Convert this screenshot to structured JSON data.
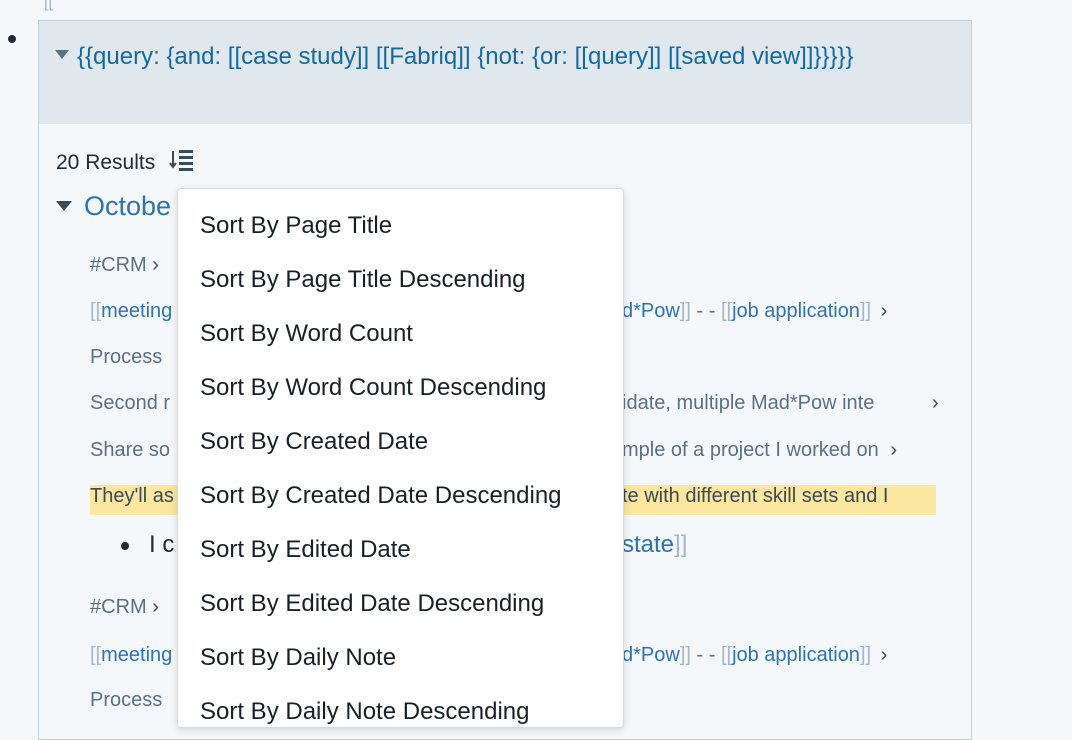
{
  "query": {
    "text": "{{query:  {and: [[case study]] [[Fabriq]] {not: {or: [[query]] [[saved view]]}}}}}"
  },
  "results": {
    "count_label": "20 Results"
  },
  "group": {
    "title": "Octobe"
  },
  "rows": {
    "crm1": "#CRM",
    "meeting1_open": "[[",
    "meeting1_text": "meeting",
    "madpow1": "d*Pow",
    "madpow1_close": "]]",
    "dash1": " - - ",
    "job1_open": "[[",
    "job1_text": "job application",
    "job1_close": "]]",
    "process1": "Process",
    "second_left": "Second r",
    "second_right": "idate, multiple Mad*Pow inte",
    "share_left": "Share so",
    "share_right": "mple of a project I worked on",
    "theyll_left": "They'll as",
    "theyll_right": "te with different skill sets and I",
    "ic_left": "I c",
    "state_text": "state",
    "state_close": "]]",
    "crm2": "#CRM",
    "meeting2_open": "[[",
    "meeting2_text": "meeting",
    "madpow2": "d*Pow",
    "madpow2_close": "]]",
    "dash2": " - - ",
    "job2_open": "[[",
    "job2_text": "job application",
    "job2_close": "]]",
    "process2": "Process",
    "chevron": "›",
    "top_ghost": "[["
  },
  "sort_menu": {
    "items": [
      "Sort By Page Title",
      "Sort By Page Title Descending",
      "Sort By Word Count",
      "Sort By Word Count Descending",
      "Sort By Created Date",
      "Sort By Created Date Descending",
      "Sort By Edited Date",
      "Sort By Edited Date Descending",
      "Sort By Daily Note",
      "Sort By Daily Note Descending"
    ]
  },
  "colors": {
    "link": "#2d72b8",
    "highlight": "#fbe7a0",
    "header_bg": "#e1e8ed"
  }
}
